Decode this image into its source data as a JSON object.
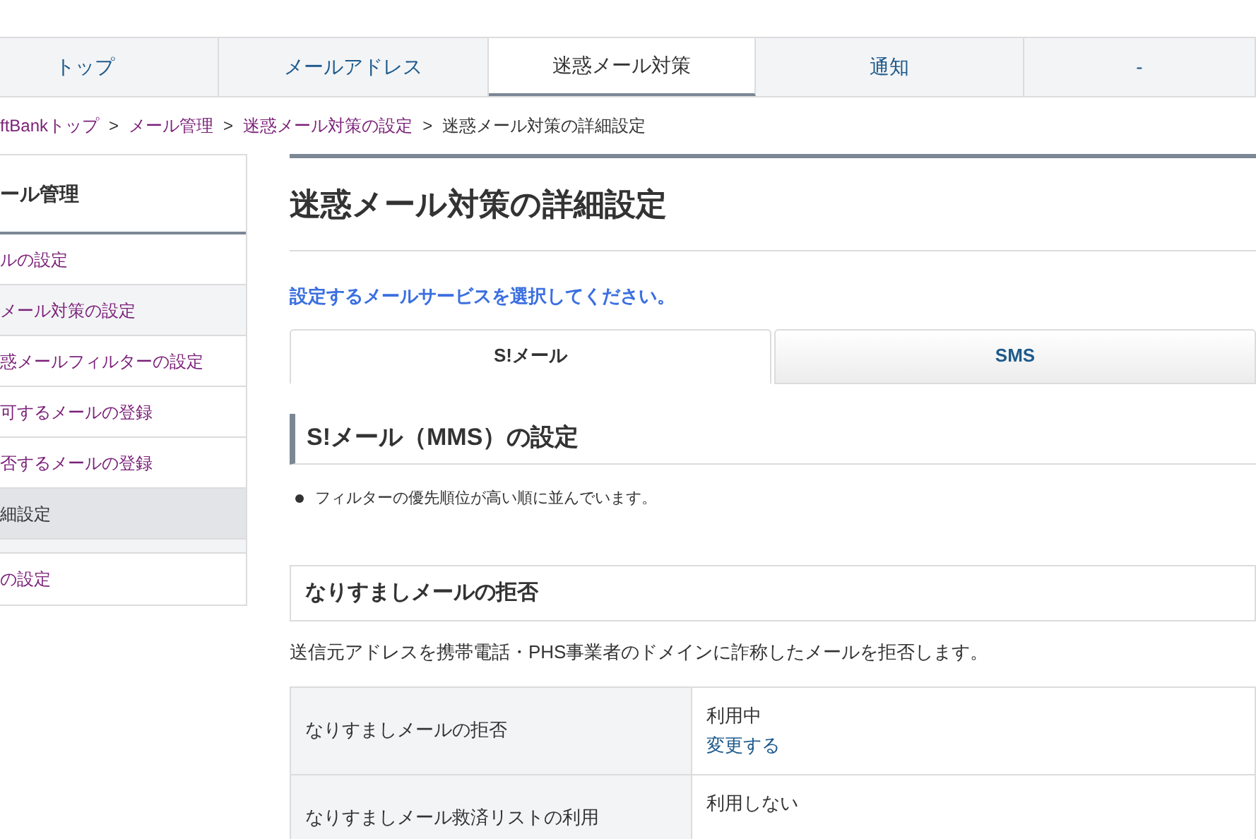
{
  "global_tabs": [
    {
      "label": "トップ",
      "selected": false
    },
    {
      "label": "メールアドレス",
      "selected": false
    },
    {
      "label": "迷惑メール対策",
      "selected": true
    },
    {
      "label": "通知",
      "selected": false
    },
    {
      "label": "-",
      "selected": false
    }
  ],
  "breadcrumb": {
    "links": [
      "ftBankトップ",
      "メール管理",
      "迷惑メール対策の設定"
    ],
    "current": "迷惑メール対策の詳細設定",
    "separator": ">"
  },
  "sidebar": {
    "title": "ール管理",
    "items": [
      {
        "label": "ルの設定",
        "selected": false,
        "hovered": false
      },
      {
        "label": "メール対策の設定",
        "selected": false,
        "hovered": true
      },
      {
        "label": "惑メールフィルターの設定",
        "selected": false,
        "hovered": false
      },
      {
        "label": "可するメールの登録",
        "selected": false,
        "hovered": false
      },
      {
        "label": "否するメールの登録",
        "selected": false,
        "hovered": false
      },
      {
        "label": "細設定",
        "selected": true,
        "hovered": false
      },
      {
        "label": "の設定",
        "selected": false,
        "hovered": false
      }
    ]
  },
  "main": {
    "title": "迷惑メール対策の詳細設定",
    "prompt": "設定するメールサービスを選択してください。",
    "service_tabs": [
      {
        "label": "S!メール",
        "selected": true
      },
      {
        "label": "SMS",
        "selected": false
      }
    ],
    "section_title": "S!メール（MMS）の設定",
    "notes": [
      "フィルターの優先順位が高い順に並んでいます。"
    ],
    "subsection_title": "なりすましメールの拒否",
    "description": "送信元アドレスを携帯電話・PHS事業者のドメインに詐称したメールを拒否します。",
    "settings": [
      {
        "name": "なりすましメールの拒否",
        "status": "利用中",
        "action": "変更する"
      },
      {
        "name": "なりすましメール救済リストの利用",
        "status": "利用しない"
      }
    ]
  }
}
